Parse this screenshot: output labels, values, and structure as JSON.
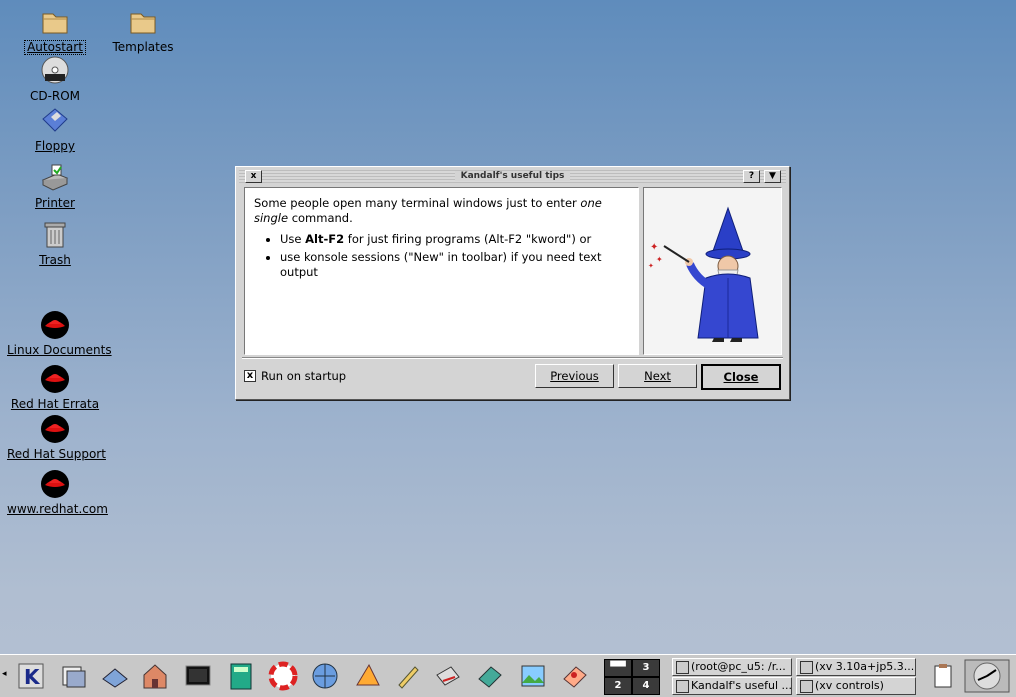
{
  "desktop": {
    "icons": [
      {
        "label": "Autostart",
        "icon": "folder-icon"
      },
      {
        "label": "Templates",
        "icon": "folder-icon"
      },
      {
        "label": "CD-ROM",
        "icon": "cdrom-icon"
      },
      {
        "label": "Floppy",
        "icon": "floppy-icon"
      },
      {
        "label": "Printer",
        "icon": "printer-icon"
      },
      {
        "label": "Trash",
        "icon": "trash-icon"
      },
      {
        "label": "Linux Documents",
        "icon": "redhat-icon"
      },
      {
        "label": "Red Hat Errata",
        "icon": "redhat-icon"
      },
      {
        "label": "Red Hat Support",
        "icon": "redhat-icon"
      },
      {
        "label": "www.redhat.com",
        "icon": "redhat-icon"
      }
    ]
  },
  "dialog": {
    "title": "Kandalf's useful tips",
    "close_glyph": "x",
    "help_glyph": "?",
    "menu_glyph": "▼",
    "tip_intro_a": "Some people open many terminal windows just to enter ",
    "tip_intro_em": "one single",
    "tip_intro_b": " command.",
    "bullets": [
      {
        "pre": "Use ",
        "strong": "Alt-F2",
        "post": " for just firing programs (Alt-F2 \"kword\") or"
      },
      {
        "pre": "use konsole sessions (\"New\" in toolbar) if you need text output",
        "strong": "",
        "post": ""
      }
    ],
    "run_on_startup_label": "Run on startup",
    "run_on_startup_checked": "x",
    "buttons": {
      "previous": "Previous",
      "next": "Next",
      "close": "Close"
    }
  },
  "taskbar": {
    "pager": [
      "1",
      "3",
      "2",
      "4"
    ],
    "tasks": [
      "(root@pc_u5: /r...",
      "Kandalf's useful ...",
      "(xv 3.10a+jp5.3....",
      "(xv controls)"
    ],
    "colors": {
      "desktop_top": "#5f8cbc",
      "desktop_bottom": "#b4c0d2",
      "panel": "#c8c8c8"
    }
  }
}
